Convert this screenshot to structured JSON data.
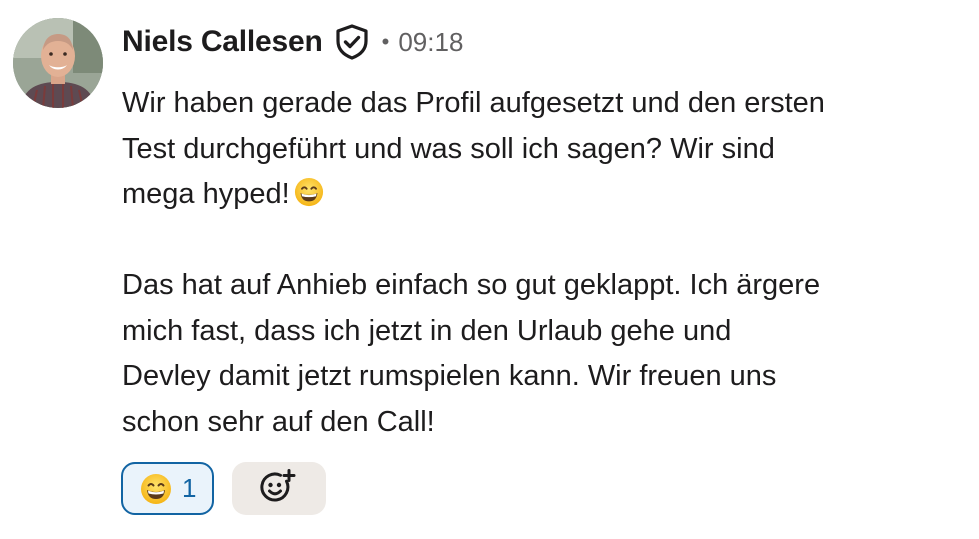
{
  "message": {
    "author": "Niels Callesen",
    "separator": "•",
    "timestamp": "09:18",
    "paragraph_1": "Wir haben gerade das Profil aufgesetzt und den ersten\nTest durchgeführt und was soll ich sagen? Wir sind\nmega hyped!",
    "paragraph_2": "Das hat auf Anhieb einfach so gut geklappt. Ich ärgere\nmich fast, dass ich jetzt in den Urlaub gehe und\nDevley damit jetzt rumspielen kann. Wir freuen uns\nschon sehr auf den Call!",
    "inline_emoji": "grinning-face-with-smiling-eyes"
  },
  "icons": {
    "verified": "shield-check-icon",
    "add_reaction": "add-emoji-icon"
  },
  "reactions": [
    {
      "emoji": "grinning-face-with-smiling-eyes",
      "count": "1",
      "selected": true
    }
  ],
  "colors": {
    "accent": "#1264a3",
    "text": "#1d1c1d",
    "muted": "#616061",
    "add_reaction_bg": "#eeeae6"
  }
}
